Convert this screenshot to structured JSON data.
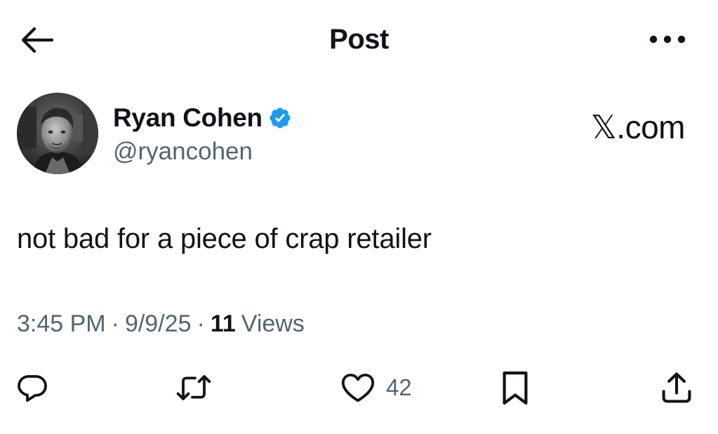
{
  "header": {
    "title": "Post",
    "back_icon": "arrow-left-icon",
    "more_icon": "more-horizontal-icon"
  },
  "author": {
    "display_name": "Ryan Cohen",
    "handle": "@ryancohen",
    "verified": true,
    "verified_color": "#1d9bf0"
  },
  "site_mark": "𝕏.com",
  "post": {
    "text": "not bad for a piece of crap retailer",
    "time": "3:45 PM",
    "separator": "·",
    "date": "9/9/25",
    "views_count": "11",
    "views_label": "Views"
  },
  "actions": {
    "reply_icon": "reply-icon",
    "repost_icon": "repost-icon",
    "like_icon": "heart-icon",
    "like_count": "42",
    "bookmark_icon": "bookmark-icon",
    "share_icon": "share-icon"
  },
  "colors": {
    "text_primary": "#0f1419",
    "text_secondary": "#536471",
    "accent": "#1d9bf0"
  }
}
